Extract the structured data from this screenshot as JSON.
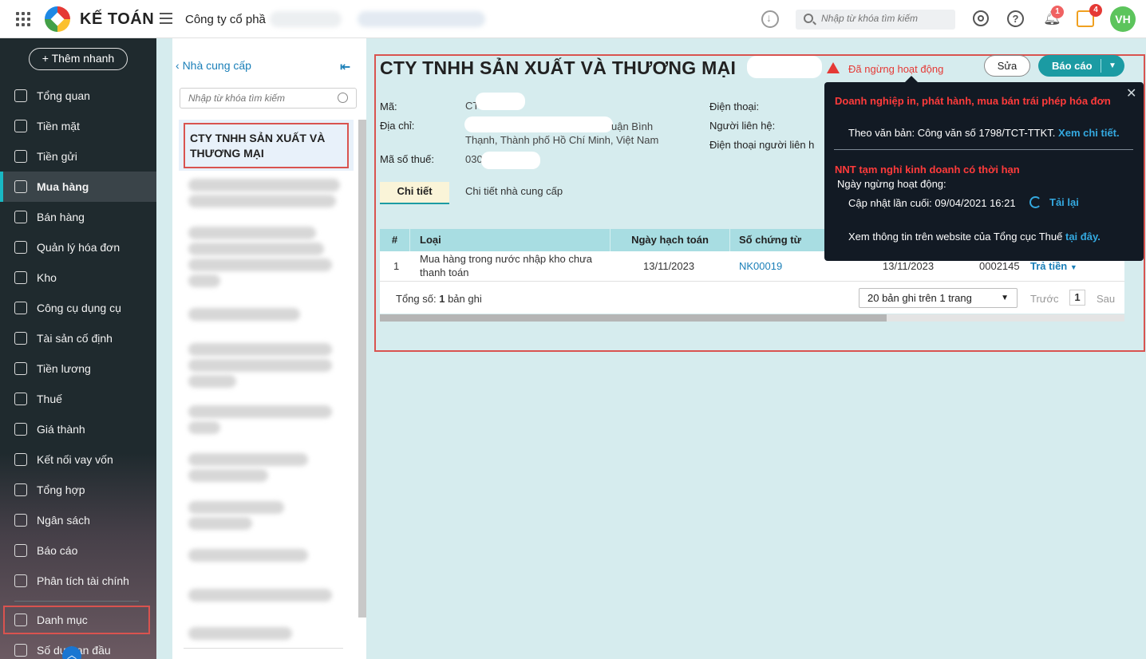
{
  "topbar": {
    "brand": "KẾ TOÁN",
    "company": "Công ty cổ phầ",
    "search_placeholder": "Nhập từ khóa tìm kiếm",
    "notif_count": "1",
    "mail_count": "4",
    "avatar": "VH"
  },
  "sidebar": {
    "quick_add": "+ Thêm nhanh",
    "items": [
      {
        "label": "Tổng quan",
        "icon": "dashboard-icon"
      },
      {
        "label": "Tiền mặt",
        "icon": "cash-icon"
      },
      {
        "label": "Tiền gửi",
        "icon": "deposit-icon"
      },
      {
        "label": "Mua hàng",
        "icon": "shopping-bag-icon"
      },
      {
        "label": "Bán hàng",
        "icon": "cart-icon"
      },
      {
        "label": "Quản lý hóa đơn",
        "icon": "invoice-icon"
      },
      {
        "label": "Kho",
        "icon": "warehouse-icon"
      },
      {
        "label": "Công cụ dụng cụ",
        "icon": "tools-icon"
      },
      {
        "label": "Tài sản cố định",
        "icon": "asset-icon"
      },
      {
        "label": "Tiền lương",
        "icon": "salary-icon"
      },
      {
        "label": "Thuế",
        "icon": "tax-icon"
      },
      {
        "label": "Giá thành",
        "icon": "price-tag-icon"
      },
      {
        "label": "Kết nối vay vốn",
        "icon": "loan-icon"
      },
      {
        "label": "Tổng hợp",
        "icon": "summary-icon"
      },
      {
        "label": "Ngân sách",
        "icon": "budget-icon"
      },
      {
        "label": "Báo cáo",
        "icon": "report-icon"
      },
      {
        "label": "Phân tích tài chính",
        "icon": "analytics-icon"
      },
      {
        "label": "Danh mục",
        "icon": "list-icon"
      },
      {
        "label": "Số dư ban đầu",
        "icon": "balance-icon"
      }
    ]
  },
  "list": {
    "back": "Nhà cung cấp",
    "search_placeholder": "Nhập từ khóa tìm kiếm",
    "selected": "CTY TNHH SẢN XUẤT VÀ THƯƠNG MẠI"
  },
  "detail": {
    "title": "CTY TNHH SẢN XUẤT VÀ THƯƠNG MẠI",
    "status": "Đã ngừng hoạt động",
    "edit_label": "Sửa",
    "report_label": "Báo cáo",
    "fields": {
      "code_label": "Mã:",
      "code_value": "CT",
      "address_label": "Địa chỉ:",
      "address_line1": "uận Bình",
      "address_line2": "Thạnh, Thành phố Hồ Chí Minh, Việt Nam",
      "tax_label": "Mã số thuế:",
      "tax_value": "030",
      "phone_label": "Điện thoại:",
      "contact_label": "Người liên hệ:",
      "contact_phone_label": "Điện thoại người liên h"
    },
    "tabs": [
      "Chi tiết",
      "Chi tiết nhà cung cấp"
    ],
    "table": {
      "headers": [
        "#",
        "Loại",
        "Ngày hạch toán",
        "Số chứng từ"
      ],
      "row": {
        "index": "1",
        "type_line1": "Mua hàng trong nước nhập kho chưa",
        "type_line2": "thanh toán",
        "date": "13/11/2023",
        "doc_no": "NK00019",
        "date2": "13/11/2023",
        "invoice_no": "0002145",
        "action": "Trả tiền"
      }
    },
    "total_label": "Tổng số:",
    "total_value": "1",
    "total_suffix": "bản ghi",
    "pager": {
      "page_size": "20 bản ghi trên 1 trang",
      "prev": "Trước",
      "page": "1",
      "next": "Sau"
    }
  },
  "tooltip": {
    "alert1": "Doanh nghiệp in, phát hành, mua bán trái phép hóa đơn",
    "doc_text": "Theo văn bản: Công văn số 1798/TCT-TTKT.",
    "doc_link": "Xem chi tiết.",
    "alert2": "NNT tạm nghỉ kinh doanh có thời hạn",
    "stop_date_label": "Ngày ngừng hoạt động:",
    "updated": "Cập nhật lần cuối: 09/04/2021 16:21",
    "reload": "Tải lại",
    "website_text": "Xem thông tin trên website của Tổng cục Thuế",
    "website_link": "tại đây."
  }
}
